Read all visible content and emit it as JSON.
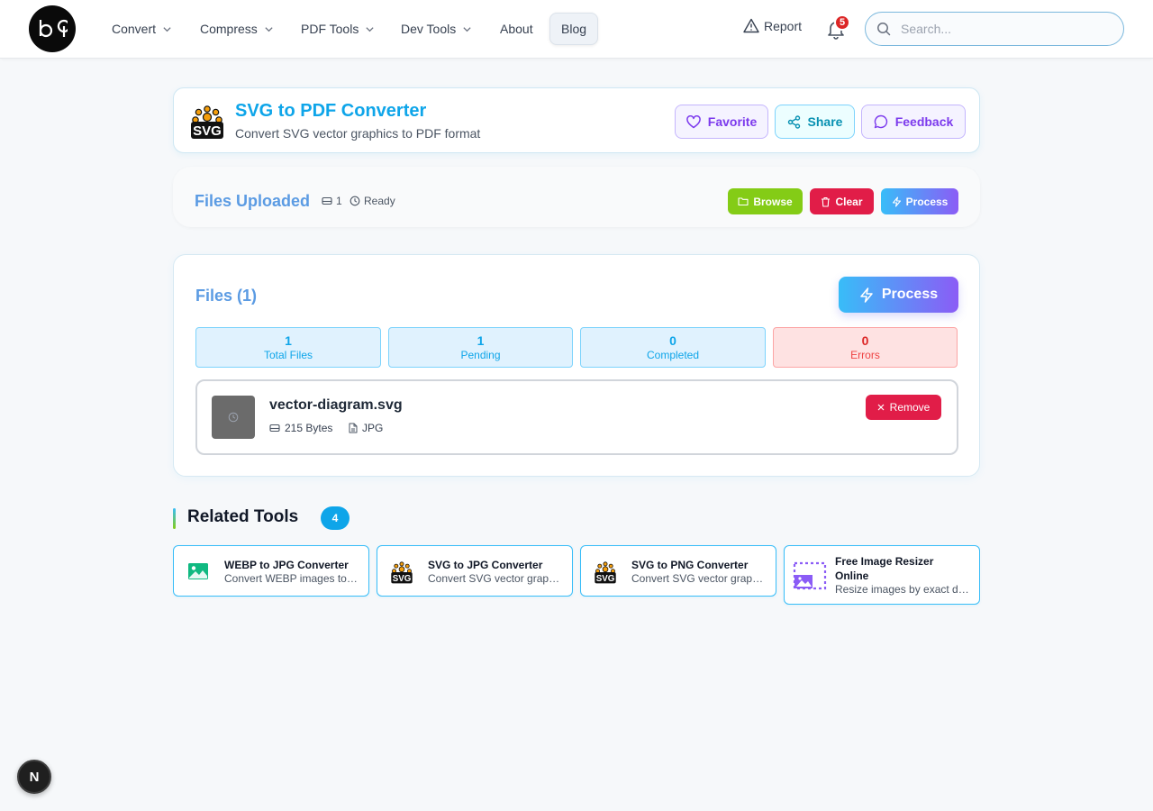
{
  "nav": {
    "items": [
      {
        "label": "Convert"
      },
      {
        "label": "Compress"
      },
      {
        "label": "PDF Tools"
      },
      {
        "label": "Dev Tools"
      },
      {
        "label": "About"
      },
      {
        "label": "Blog"
      }
    ],
    "report_label": "Report",
    "notification_count": "5",
    "search_placeholder": "Search..."
  },
  "header": {
    "title": "SVG to PDF Converter",
    "subtitle": "Convert SVG vector graphics to PDF format",
    "favorite_label": "Favorite",
    "share_label": "Share",
    "feedback_label": "Feedback"
  },
  "upload": {
    "title": "Files Uploaded",
    "count": "1",
    "status": "Ready",
    "browse_label": "Browse",
    "clear_label": "Clear",
    "process_label": "Process"
  },
  "files": {
    "title": "Files (1)",
    "process_label": "Process",
    "stats": [
      {
        "value": "1",
        "label": "Total Files"
      },
      {
        "value": "1",
        "label": "Pending"
      },
      {
        "value": "0",
        "label": "Completed"
      },
      {
        "value": "0",
        "label": "Errors"
      }
    ],
    "items": [
      {
        "name": "vector-diagram.svg",
        "size": "215 Bytes",
        "format": "JPG",
        "remove_label": "Remove"
      }
    ]
  },
  "related": {
    "title": "Related Tools",
    "count": "4",
    "tools": [
      {
        "name": "WEBP to JPG Converter",
        "desc": "Convert WEBP images to JPG format",
        "icon": "image-icon"
      },
      {
        "name": "SVG to JPG Converter",
        "desc": "Convert SVG vector graphics to JPG",
        "icon": "svg-icon"
      },
      {
        "name": "SVG to PNG Converter",
        "desc": "Convert SVG vector graphics to PNG",
        "icon": "svg-icon"
      },
      {
        "name": "Free Image Resizer Online",
        "desc": "Resize images by exact dimensions",
        "icon": "resize-icon"
      }
    ]
  },
  "dev_badge": "N",
  "colors": {
    "accent": "#0ea5e9",
    "purple": "#7c3aed",
    "danger": "#e11d48",
    "success": "#84cc16"
  }
}
